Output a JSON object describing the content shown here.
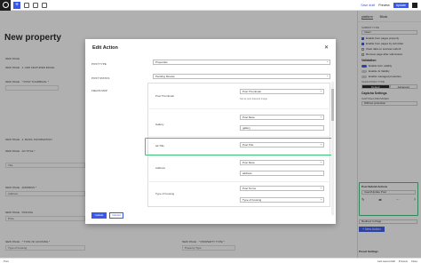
{
  "topbar": {
    "save_draft": "Save draft",
    "preview": "Preview",
    "update_label": "Update"
  },
  "page": {
    "title": "New property"
  },
  "background": {
    "labels": [
      "NEW PAGE",
      "NEW PAGE · 1. ADD FEATURED IMAGE",
      "NEW PAGE · * POST THUMBNAIL *",
      "NEW PAGE · 2. BASIC INFORMATION",
      "NEW PAGE · AD TITLE *",
      "NEW PAGE · ADDRESS *",
      "NEW PAGE · PRICING",
      "NEW PAGE · * TYPE OF HOUSING *",
      "NEW PAGE · * PROPERTY TYPE *"
    ],
    "fields": [
      "Title",
      "Address",
      "Price"
    ],
    "type_of_housing": "Type of housing",
    "property_type": "Property Type"
  },
  "sidebar": {
    "tabs": [
      "platform",
      "Block"
    ],
    "post_type_label": "SUBMIT TYPE",
    "post_type_value": "Insert",
    "checks": [
      {
        "label": "Enable from pages property",
        "on": true
      },
      {
        "label": "Enable from pages by submitter",
        "on": true
      },
      {
        "label": "Clear data on success submit",
        "on": false
      },
      {
        "label": "Remove page after submission",
        "on": false
      }
    ],
    "validation_head": "Validation",
    "toggles": [
      {
        "label": "Enable form validity",
        "on": true
      },
      {
        "label": "Enable Js Validity",
        "on": false
      },
      {
        "label": "Enable managed protection",
        "on": false
      }
    ],
    "validation_type_label": "VALIDATION TYPE",
    "seg_default": "Default",
    "seg_advanced": "Advanced",
    "captcha_head": "Captcha Settings",
    "captcha_label": "CAPTCHA PROVIDER",
    "captcha_value": "Without protection"
  },
  "post_submit": {
    "head": "Post Submit Actions",
    "action_value": "Insert/Update Post",
    "below_value": "Redirect to Page",
    "add_action": "+ New Action",
    "bottom_head": "Preset Settings"
  },
  "modal": {
    "title": "Edit Action",
    "close": "✕",
    "post_type_label": "POST TYPE",
    "post_type_value": "Properties",
    "post_status_label": "POST STATUS",
    "post_status_value": "Pending Review",
    "fields_map_label": "FIELDS MAP",
    "rows": [
      {
        "name": "Post Thumbnail",
        "value": "Post Thumbnail",
        "hint": "Set as post featured image"
      },
      {
        "name": "Gallery",
        "value": "Post Meta",
        "meta": "gallery"
      },
      {
        "name": "ad-Title",
        "value": "Post Title"
      },
      {
        "name": "Address",
        "value": "Post Meta",
        "meta": "address"
      },
      {
        "name": "Type of housing",
        "value": "Post Terms",
        "meta": "Type of housing"
      }
    ],
    "update_button": "Update",
    "cancel_button": "Cancel"
  },
  "statusbar": {
    "left": "Post",
    "right": [
      "Last saved draft",
      "Preview",
      "Close"
    ]
  }
}
